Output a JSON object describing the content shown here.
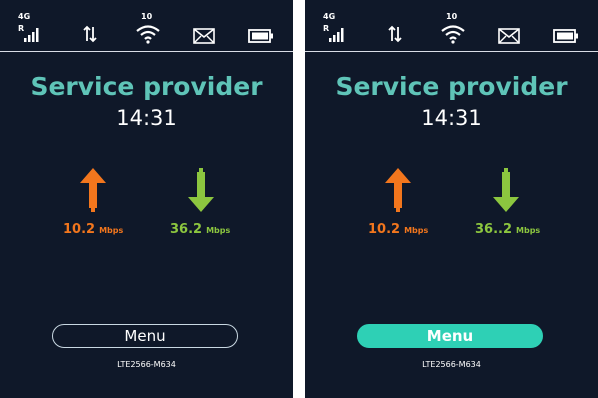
{
  "colors": {
    "background": "#0f1829",
    "accent_teal": "#5fc4b8",
    "upload_orange": "#f2761d",
    "download_green": "#8cc63f",
    "menu_active": "#2ed0b5"
  },
  "screens": [
    {
      "state": "menu-unselected",
      "status": {
        "network": "4G",
        "network_icon": "signal-bars-icon",
        "data_icon": "up-down-arrows-icon",
        "wifi_clients": "10",
        "wifi_icon": "wifi-icon",
        "mail_icon": "envelope-icon",
        "battery_icon": "battery-icon"
      },
      "provider": "Service provider",
      "time": "14:31",
      "upload": {
        "value": "10.2",
        "unit": "Mbps"
      },
      "download": {
        "value": "36.2",
        "unit": "Mbps"
      },
      "menu_label": "Menu",
      "model": "LTE2566-M634"
    },
    {
      "state": "menu-highlighted",
      "status": {
        "network": "4G",
        "network_icon": "signal-bars-icon",
        "data_icon": "up-down-arrows-icon",
        "wifi_clients": "10",
        "wifi_icon": "wifi-icon",
        "mail_icon": "envelope-icon",
        "battery_icon": "battery-icon"
      },
      "provider": "Service provider",
      "time": "14:31",
      "upload": {
        "value": "10.2",
        "unit": "Mbps"
      },
      "download": {
        "value": "36..2",
        "unit": "Mbps"
      },
      "menu_label": "Menu",
      "model": "LTE2566-M634"
    }
  ]
}
